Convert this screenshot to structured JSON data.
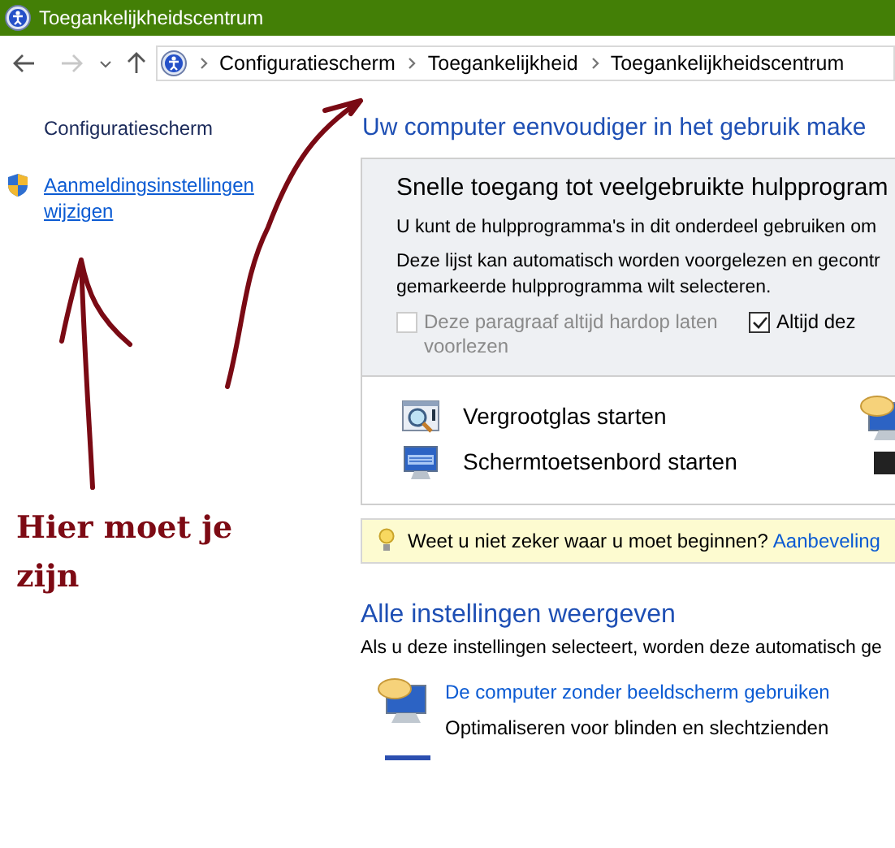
{
  "window": {
    "title": "Toegankelijkheidscentrum"
  },
  "breadcrumb": [
    "Configuratiescherm",
    "Toegankelijkheid",
    "Toegankelijkheidscentrum"
  ],
  "sidebar": {
    "home": "Configuratiescherm",
    "links": [
      {
        "label": "Aanmeldingsinstellingen wijzigen",
        "shield": true
      }
    ]
  },
  "annotation": {
    "text": "Hier moet je zijn"
  },
  "main": {
    "heading": "Uw computer eenvoudiger in het gebruik make",
    "quick": {
      "title": "Snelle toegang tot veelgebruikte hulpprogram",
      "lines": [
        "U kunt de hulpprogramma's in dit onderdeel gebruiken om",
        "Deze lijst kan automatisch worden voorgelezen en gecontr\ngemarkeerde hulpprogramma wilt selecteren."
      ],
      "options": [
        {
          "label": "Deze paragraaf altijd hardop laten voorlezen",
          "checked": false,
          "disabled": true
        },
        {
          "label": "Altijd dez",
          "checked": true,
          "disabled": false
        }
      ],
      "tools": [
        {
          "label": "Vergrootglas starten",
          "kind": "magnifier"
        },
        {
          "label": "Schermtoetsenbord starten",
          "kind": "keyboard"
        }
      ]
    },
    "tip": {
      "text": "Weet u niet zeker waar u moet beginnen?",
      "link": "Aanbeveling"
    },
    "all": {
      "title": "Alle instellingen weergeven",
      "desc": "Als u deze instellingen selecteert, worden deze automatisch ge",
      "items": [
        {
          "link": "De computer zonder beeldscherm gebruiken",
          "desc": "Optimaliseren voor blinden en slechtzienden"
        }
      ]
    }
  }
}
